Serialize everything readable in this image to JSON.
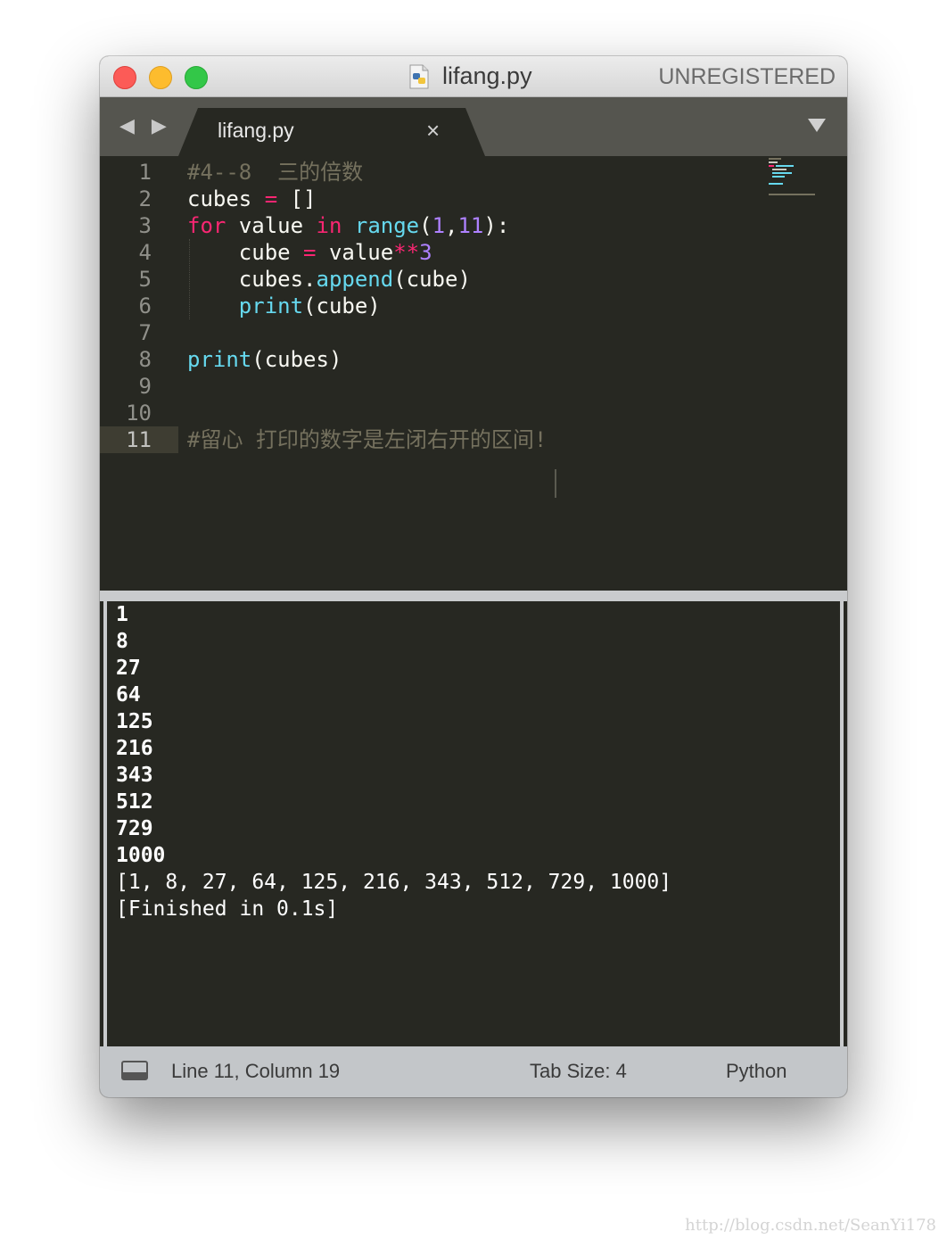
{
  "window": {
    "title": "lifang.py",
    "license_status": "UNREGISTERED"
  },
  "tabbar": {
    "nav_arrows": "◀ ▶",
    "tabs": [
      {
        "label": "lifang.py",
        "close": "×"
      }
    ]
  },
  "editor": {
    "line_numbers": [
      "1",
      "2",
      "3",
      "4",
      "5",
      "6",
      "7",
      "8",
      "9",
      "10",
      "11"
    ],
    "active_line": "11",
    "code": {
      "l1_comment": "#4--8  三的倍数",
      "l2_var": "cubes",
      "l2_eq": "=",
      "l2_val": "[]",
      "l3_for": "for",
      "l3_value": "value",
      "l3_in": "in",
      "l3_range": "range",
      "l3_open": "(",
      "l3_n1": "1",
      "l3_comma": ",",
      "l3_n2": "11",
      "l3_close": "):",
      "l4_var": "cube",
      "l4_eq": "=",
      "l4_value": "value",
      "l4_pow": "**",
      "l4_n": "3",
      "l5_obj": "cubes.",
      "l5_fn": "append",
      "l5_args": "(cube)",
      "l6_fn": "print",
      "l6_args": "(cube)",
      "l8_fn": "print",
      "l8_args": "(cubes)",
      "l11_comment": "#留心 打印的数字是左闭右开的区间!"
    }
  },
  "console": {
    "lines": [
      "1",
      "8",
      "27",
      "64",
      "125",
      "216",
      "343",
      "512",
      "729",
      "1000",
      "[1, 8, 27, 64, 125, 216, 343, 512, 729, 1000]",
      "[Finished in 0.1s]"
    ]
  },
  "statusbar": {
    "position": "Line 11, Column 19",
    "tab_size": "Tab Size: 4",
    "syntax": "Python"
  },
  "watermark": "http://blog.csdn.net/SeanYi178",
  "colors": {
    "background": "#272822",
    "keyword": "#f92672",
    "function": "#66d9ef",
    "number": "#ae81ff",
    "comment": "#75715e",
    "text": "#f8f8f2"
  },
  "icons": [
    "python-file-icon",
    "dropdown-arrow-icon",
    "panel-toggle-icon"
  ]
}
